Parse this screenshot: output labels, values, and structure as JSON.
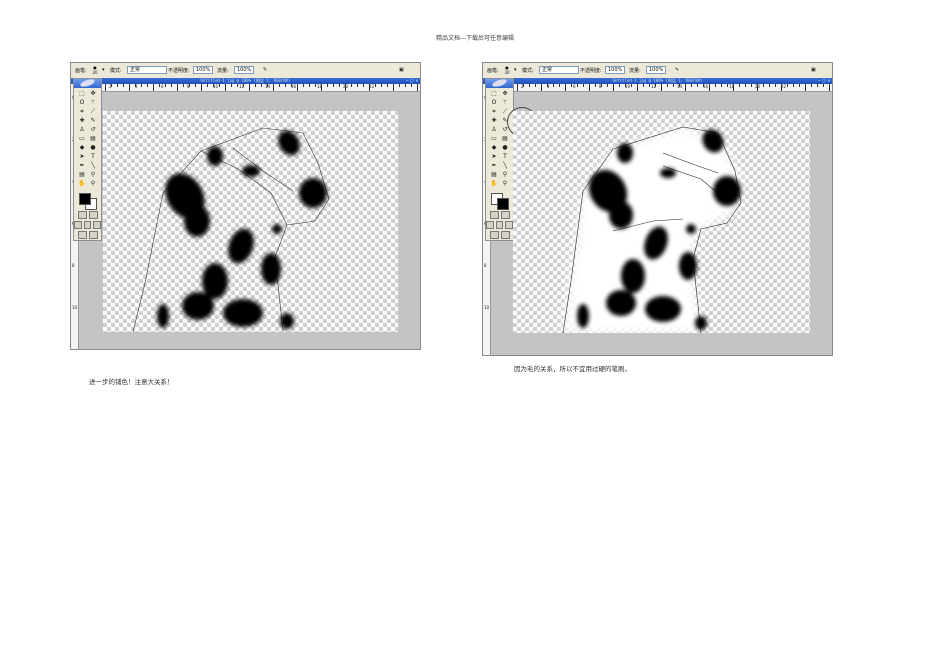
{
  "header": {
    "text": "精品文档---下载后可任意编辑"
  },
  "options_bar": {
    "brush_label": "画笔:",
    "brush_size_left": "20",
    "brush_size_right": "30",
    "mode_label": "模式:",
    "mode_value": "正常",
    "opacity_label": "不透明度:",
    "opacity_value": "100%",
    "flow_label": "流量:",
    "flow_value": "100%"
  },
  "screenshots": [
    {
      "title": "Untitled-1.jpg @ 100% (图层 1, RGB/8#)",
      "caption": "进一步的铺色！注意大关系！"
    },
    {
      "title": "Untitled-1.jpg @ 100% (图层 1, RGB/8#)",
      "caption": "因为毛的关系，所以不宜用过硬的笔刷。"
    }
  ],
  "ruler": {
    "marks": [
      "0",
      "2",
      "4",
      "6",
      "8",
      "10",
      "12",
      "14",
      "16",
      "18",
      "20",
      "22"
    ],
    "vmarks": [
      "0",
      "2",
      "4",
      "6",
      "8",
      "10"
    ]
  },
  "colors": {
    "foreground": "#000000",
    "background": "#ffffff",
    "titlebar": "#2a5cc8"
  }
}
